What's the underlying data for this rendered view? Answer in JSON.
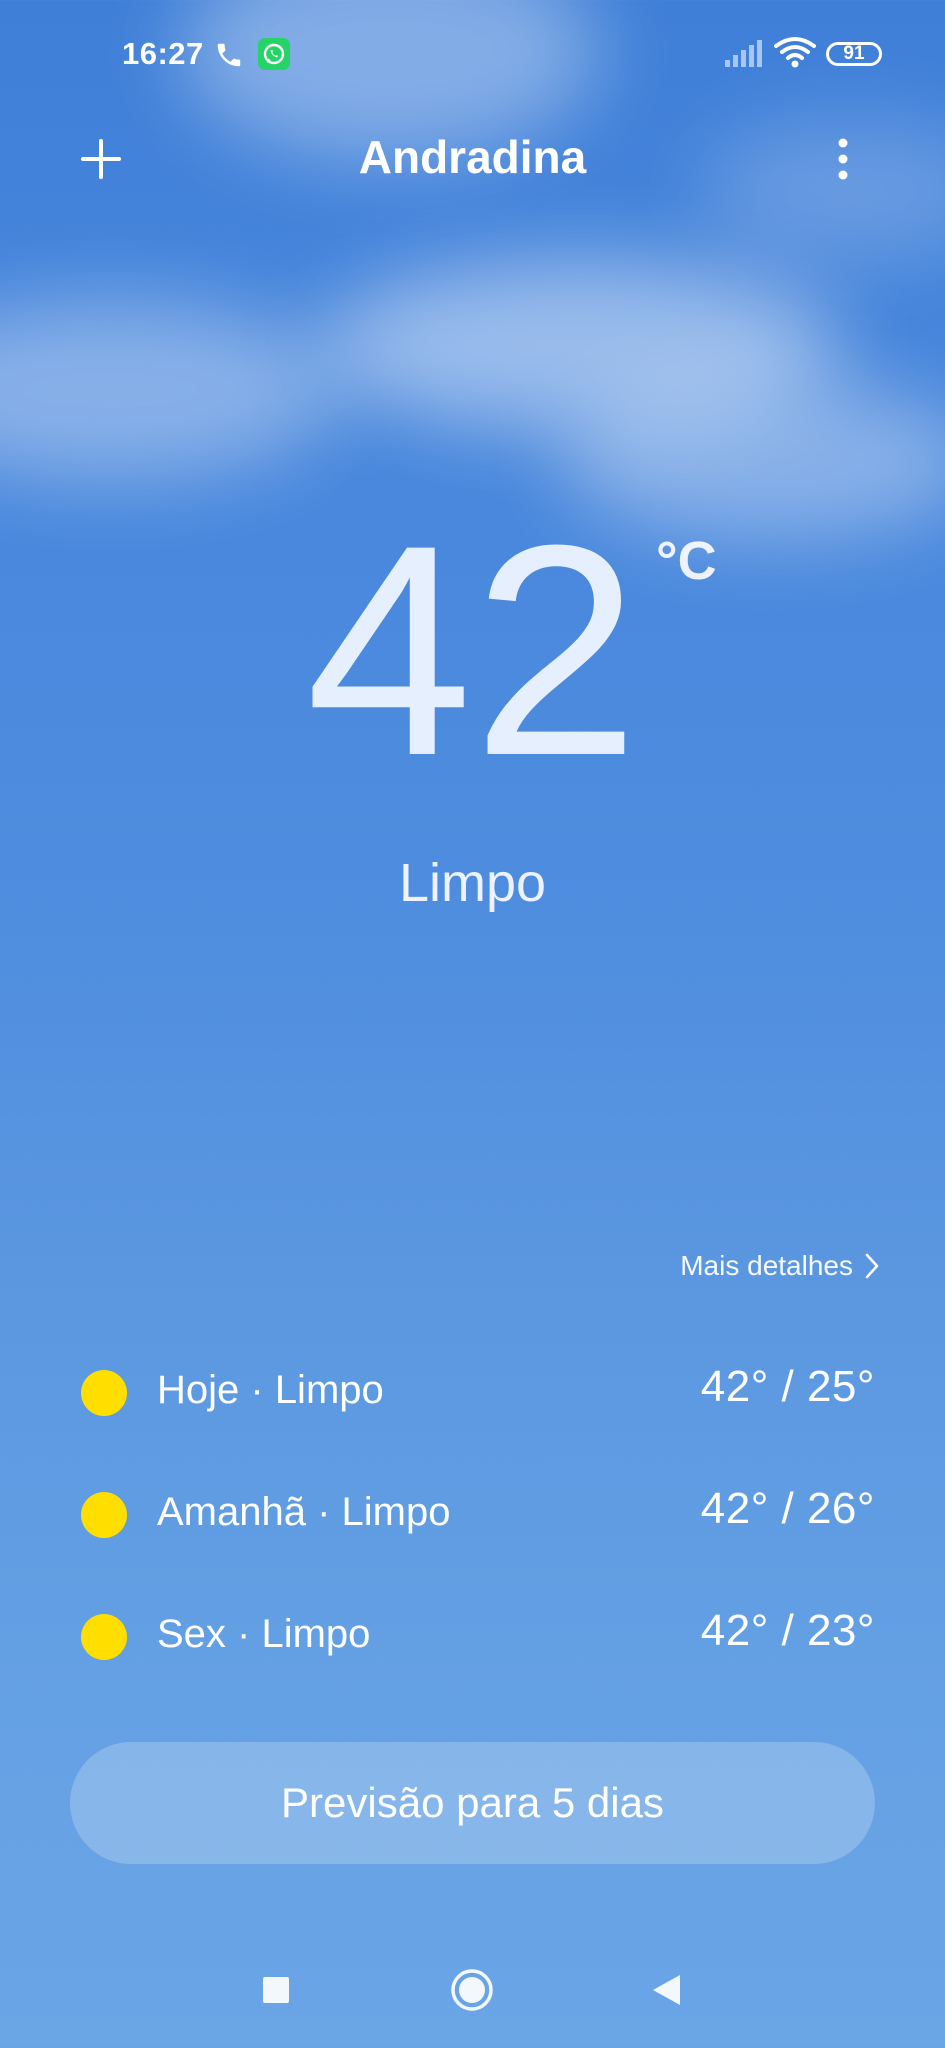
{
  "status_bar": {
    "time": "16:27",
    "battery": "91",
    "icons": [
      "phone-icon",
      "whatsapp-icon",
      "signal-icon",
      "wifi-icon",
      "battery-icon"
    ]
  },
  "header": {
    "city": "Andradina",
    "add_icon": "plus-icon",
    "menu_icon": "more-vertical-icon"
  },
  "current": {
    "temperature": "42",
    "unit": "°C",
    "condition": "Limpo"
  },
  "details_link": {
    "label": "Mais detalhes",
    "icon": "chevron-right-icon"
  },
  "forecast": [
    {
      "label": "Hoje · Limpo",
      "temps": "42° / 25°",
      "icon": "sun-icon"
    },
    {
      "label": "Amanhã · Limpo",
      "temps": "42° / 26°",
      "icon": "sun-icon"
    },
    {
      "label": "Sex · Limpo",
      "temps": "42° / 23°",
      "icon": "sun-icon"
    }
  ],
  "forecast_button": {
    "label": "Previsão para 5 dias"
  },
  "nav": {
    "icons": [
      "recents-square-icon",
      "home-circle-icon",
      "back-triangle-icon"
    ]
  },
  "colors": {
    "sky_top": "#3f7fd8",
    "sky_bottom": "#6aa6e6",
    "sun": "#ffde00",
    "whatsapp": "#25d366"
  }
}
